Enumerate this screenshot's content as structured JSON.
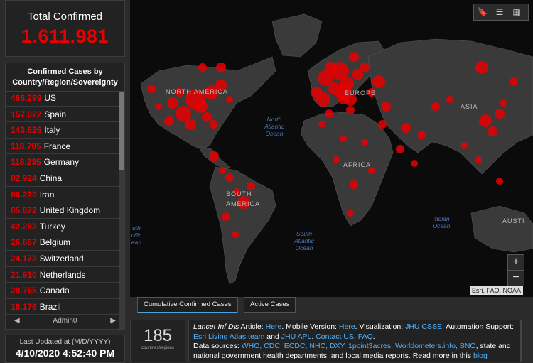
{
  "total": {
    "title": "Total Confirmed",
    "value": "1.611.981"
  },
  "countries": {
    "header": "Confirmed Cases by Country/Region/Sovereignty",
    "rows": [
      {
        "num": "466.299",
        "name": "US"
      },
      {
        "num": "157.022",
        "name": "Spain"
      },
      {
        "num": "143.626",
        "name": "Italy"
      },
      {
        "num": "118.785",
        "name": "France"
      },
      {
        "num": "118.235",
        "name": "Germany"
      },
      {
        "num": "82.924",
        "name": "China"
      },
      {
        "num": "66.220",
        "name": "Iran"
      },
      {
        "num": "65.872",
        "name": "United Kingdom"
      },
      {
        "num": "42.282",
        "name": "Turkey"
      },
      {
        "num": "26.667",
        "name": "Belgium"
      },
      {
        "num": "24.172",
        "name": "Switzerland"
      },
      {
        "num": "21.910",
        "name": "Netherlands"
      },
      {
        "num": "20.765",
        "name": "Canada"
      },
      {
        "num": "18.176",
        "name": "Brazil"
      }
    ],
    "pager": "Admin0"
  },
  "updated": {
    "label": "Last Updated at (M/D/YYYY)",
    "date": "4/10/2020 4:52:40 PM"
  },
  "map": {
    "labels": {
      "north_america": "NORTH AMERICA",
      "europe": "EUROPE",
      "asia": "ASIA",
      "africa": "AFRICA",
      "south_america": "SOUTH AMERICA",
      "austr": "AUSTI"
    },
    "oceans": {
      "north_atlantic": "North Atlantic Ocean",
      "south_atlantic": "South Atlantic Ocean",
      "indian": "Indian Ocean",
      "south_pacific": "uth cific ean"
    },
    "attribution": "Esri, FAO, NOAA",
    "toolbar_icons": [
      "bookmark-icon",
      "list-icon",
      "grid-icon"
    ],
    "zoom_in": "+",
    "zoom_out": "−",
    "marker_color": "#e60000"
  },
  "tabs": {
    "cumulative": "Cumulative Confirmed Cases",
    "active": "Active Cases"
  },
  "count": {
    "number": "185",
    "label": "countries/regions"
  },
  "info": {
    "lancet": "Lancet Inf Dis",
    "t1": " Article: ",
    "here1": "Here",
    "t2": ". Mobile Version: ",
    "here2": "Here",
    "t3": ". Visualization: ",
    "jhu_csse": "JHU CSSE",
    "t4": ". Automation Support: ",
    "esri": "Esri Living Atlas team",
    "t5": " and ",
    "jhu_apl": "JHU APL",
    "t6": ". ",
    "contact": "Contact US",
    "t7": ". ",
    "faq": "FAQ",
    "t8": ".",
    "t9": "Data sources: ",
    "sources": "WHO, CDC, ECDC, NHC, DXY, 1point3acres, Worldometers.info, BNO",
    "t10": ", state and national government health departments, and local media reports.  Read more in this ",
    "blog": "blog"
  }
}
